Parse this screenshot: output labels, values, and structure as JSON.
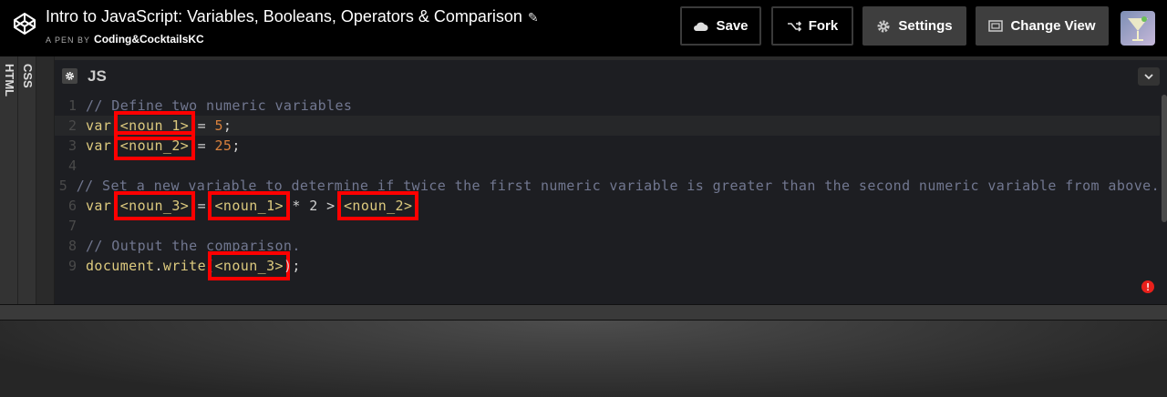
{
  "header": {
    "title": "Intro to JavaScript: Variables, Booleans, Operators & Comparison",
    "byline_prefix": "A PEN BY",
    "author": "Coding&CocktailsKC",
    "save": "Save",
    "fork": "Fork",
    "settings": "Settings",
    "change_view": "Change View"
  },
  "side_tabs": {
    "html": "HTML",
    "css": "CSS"
  },
  "editor": {
    "label": "JS",
    "line_numbers": [
      "1",
      "2",
      "3",
      "4",
      "5",
      "6",
      "7",
      "8",
      "9"
    ],
    "lines": [
      {
        "comment": "// Define two numeric variables"
      },
      {
        "kw": "var",
        "a": "<noun_1>",
        "op": " = ",
        "num": "5",
        "end": ";"
      },
      {
        "kw": "var",
        "a": "<noun_2>",
        "op": " = ",
        "num": "25",
        "end": ";"
      },
      {},
      {
        "comment": "// Set a new variable to determine if twice the first numeric variable is greater than the second numeric variable from above."
      },
      {
        "kw": "var",
        "a": "<noun_3>",
        "eq": " = ",
        "b": "<noun_1>",
        "mul": " * ",
        "two": "2",
        "gt": " > ",
        "c": "<noun_2>"
      },
      {},
      {
        "comment": "// Output the comparison."
      },
      {
        "obj": "document",
        "dot": ".",
        "fn": "write",
        "paren": "(",
        "a": "<noun_3>",
        "end": ");"
      }
    ]
  },
  "colors": {
    "highlight_box": "#ff0000",
    "keyword": "#ddca7e",
    "number": "#d9813d",
    "comment": "#717790",
    "error_badge": "#e8201b"
  },
  "icons": [
    "codepen-logo-icon",
    "pencil-icon",
    "cloud-icon",
    "fork-icon",
    "gear-icon",
    "layout-icon",
    "chevron-down-icon",
    "error-icon"
  ]
}
